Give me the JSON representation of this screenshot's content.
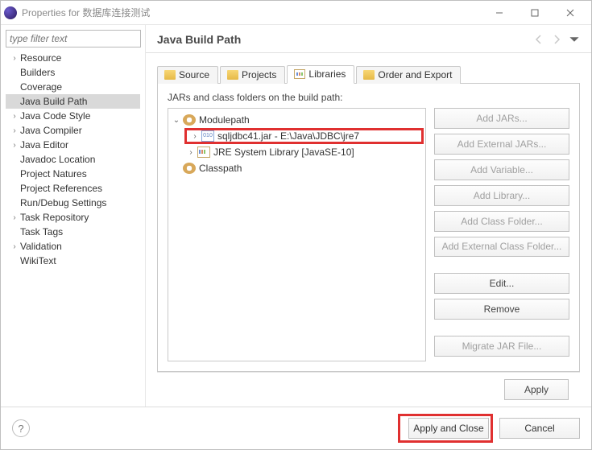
{
  "window": {
    "title": "Properties for 数据库连接测试"
  },
  "filter": {
    "placeholder": "type filter text"
  },
  "sidebar": {
    "items": [
      {
        "label": "Resource",
        "expandable": true
      },
      {
        "label": "Builders",
        "expandable": false
      },
      {
        "label": "Coverage",
        "expandable": false
      },
      {
        "label": "Java Build Path",
        "expandable": false,
        "selected": true
      },
      {
        "label": "Java Code Style",
        "expandable": true
      },
      {
        "label": "Java Compiler",
        "expandable": true
      },
      {
        "label": "Java Editor",
        "expandable": true
      },
      {
        "label": "Javadoc Location",
        "expandable": false
      },
      {
        "label": "Project Natures",
        "expandable": false
      },
      {
        "label": "Project References",
        "expandable": false
      },
      {
        "label": "Run/Debug Settings",
        "expandable": false
      },
      {
        "label": "Task Repository",
        "expandable": true
      },
      {
        "label": "Task Tags",
        "expandable": false
      },
      {
        "label": "Validation",
        "expandable": true
      },
      {
        "label": "WikiText",
        "expandable": false
      }
    ]
  },
  "header": {
    "title": "Java Build Path"
  },
  "tabs": {
    "items": [
      {
        "label": "Source",
        "icon": "ic-folder"
      },
      {
        "label": "Projects",
        "icon": "ic-proj"
      },
      {
        "label": "Libraries",
        "icon": "ic-lib",
        "active": true
      },
      {
        "label": "Order and Export",
        "icon": "ic-order"
      }
    ]
  },
  "libtab": {
    "description": "JARs and class folders on the build path:",
    "tree": [
      {
        "label": "Modulepath",
        "icon": "ji-mod",
        "level": 0,
        "expanded": true
      },
      {
        "label": "sqljdbc41.jar - E:\\Java\\JDBC\\jre7",
        "icon": "ji-jar",
        "level": 1,
        "highlight": true,
        "expandable": true
      },
      {
        "label": "JRE System Library [JavaSE-10]",
        "icon": "ji-jre",
        "level": 1,
        "expandable": true
      },
      {
        "label": "Classpath",
        "icon": "ji-cls",
        "level": 0
      }
    ],
    "buttons": [
      {
        "label": "Add JARs...",
        "disabled": true
      },
      {
        "label": "Add External JARs...",
        "disabled": true
      },
      {
        "label": "Add Variable...",
        "disabled": true
      },
      {
        "label": "Add Library...",
        "disabled": true
      },
      {
        "label": "Add Class Folder...",
        "disabled": true
      },
      {
        "label": "Add External Class Folder...",
        "disabled": true
      },
      {
        "gap": true
      },
      {
        "label": "Edit..."
      },
      {
        "label": "Remove"
      },
      {
        "gap": true
      },
      {
        "label": "Migrate JAR File...",
        "disabled": true
      }
    ]
  },
  "apply": {
    "label": "Apply"
  },
  "footer": {
    "applyClose": "Apply and Close",
    "cancel": "Cancel"
  }
}
